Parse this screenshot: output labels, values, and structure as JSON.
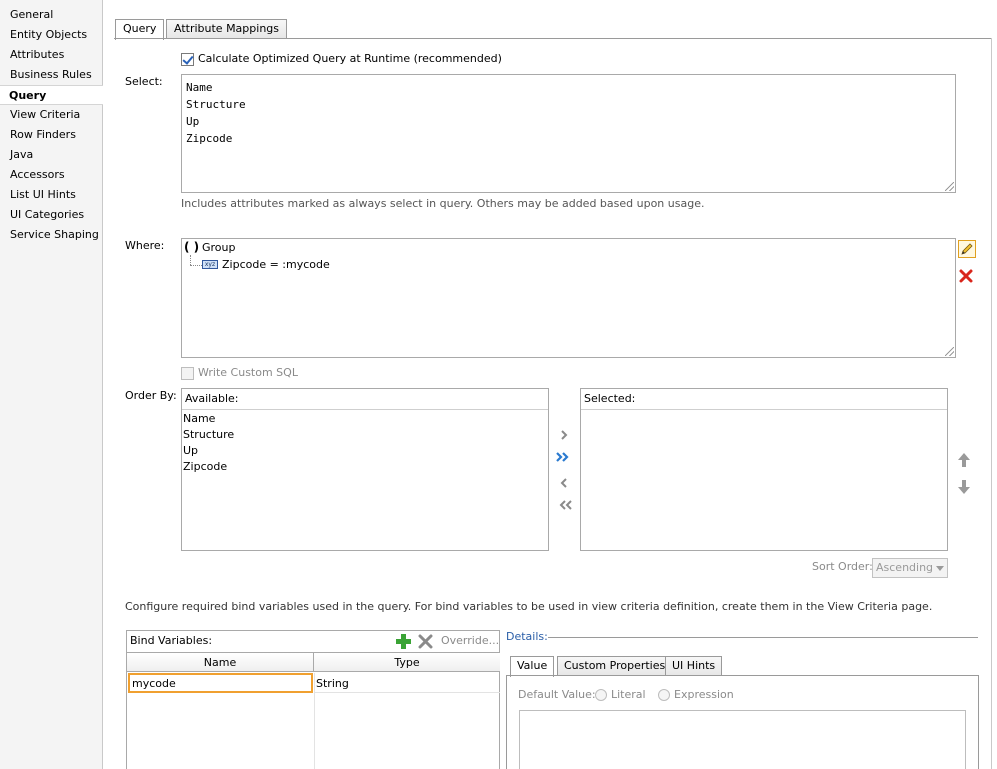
{
  "sidebar": {
    "items": [
      {
        "label": "General"
      },
      {
        "label": "Entity Objects"
      },
      {
        "label": "Attributes"
      },
      {
        "label": "Business Rules"
      },
      {
        "label": "Query",
        "selected": true
      },
      {
        "label": "View Criteria"
      },
      {
        "label": "Row Finders"
      },
      {
        "label": "Java"
      },
      {
        "label": "Accessors"
      },
      {
        "label": "List UI Hints"
      },
      {
        "label": "UI Categories"
      },
      {
        "label": "Service Shaping"
      }
    ]
  },
  "tabs": {
    "query": "Query",
    "attribute_mappings": "Attribute Mappings",
    "active": "Query"
  },
  "select": {
    "calculate_label": "Calculate Optimized Query at Runtime (recommended)",
    "calculate_checked": true,
    "label": "Select:",
    "lines": [
      "Name",
      "Structure",
      "Up",
      "Zipcode"
    ],
    "hint": "Includes attributes marked as always select in query.  Others may be added based upon usage."
  },
  "where": {
    "label": "Where:",
    "group_icon": "( )",
    "group_label": "Group",
    "condition_icon_text": "xyz",
    "condition": "Zipcode = :mycode",
    "edit_icon": "pencil-icon",
    "delete_icon": "red-x-icon"
  },
  "custom_sql": {
    "label": "Write Custom SQL",
    "checked": false,
    "enabled": false
  },
  "order_by": {
    "label": "Order By:",
    "available_header": "Available:",
    "available_items": [
      "Name",
      "Structure",
      "Up",
      "Zipcode"
    ],
    "selected_header": "Selected:",
    "selected_items": [],
    "sort_order_label": "Sort Order:",
    "sort_order_value": "Ascending"
  },
  "bind_info": "Configure required bind variables used in the query.  For bind variables to be used in view criteria definition, create them in the View Criteria page.",
  "bind_vars": {
    "title": "Bind Variables:",
    "override_label": "Override...",
    "columns": [
      "Name",
      "Type"
    ],
    "rows": [
      {
        "name": "mycode",
        "type": "String"
      }
    ]
  },
  "details": {
    "title": "Details:",
    "tabs": [
      "Value",
      "Custom Properties",
      "UI Hints"
    ],
    "active_tab": "Value",
    "default_value_label": "Default Value:",
    "literal_label": "Literal",
    "expression_label": "Expression"
  },
  "colors": {
    "selection_border": "#f0a030",
    "add_green": "#3aa335",
    "delete_red": "#d9261c",
    "arrow_blue": "#2a7ad0"
  }
}
